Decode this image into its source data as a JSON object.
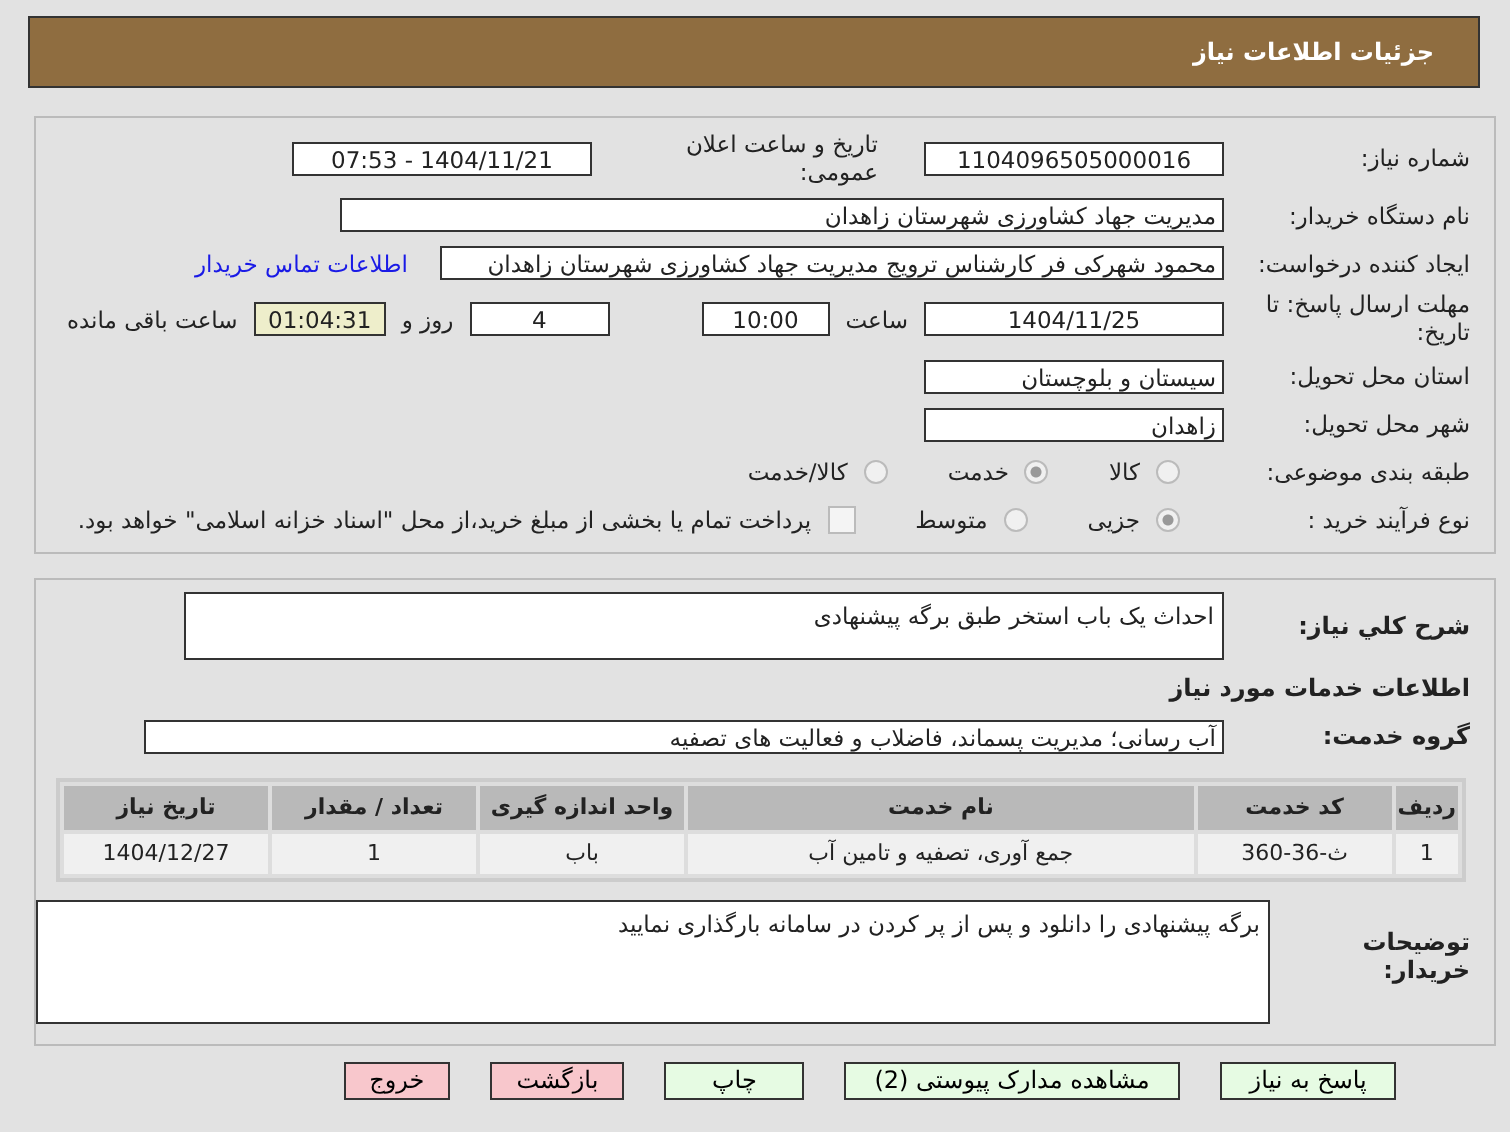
{
  "header": {
    "title": "جزئیات اطلاعات نیاز"
  },
  "need_number": {
    "label": "شماره نیاز:",
    "value": "1104096505000016"
  },
  "announce": {
    "label": "تاریخ و ساعت اعلان عمومی:",
    "value": "1404/11/21 - 07:53"
  },
  "buyer": {
    "label": "نام دستگاه خریدار:",
    "value": "مدیریت جهاد کشاورزی شهرستان زاهدان"
  },
  "creator": {
    "label": "ایجاد کننده درخواست:",
    "value": "محمود شهرکی فر کارشناس ترویج مدیریت جهاد کشاورزی شهرستان زاهدان",
    "link": "اطلاعات تماس خریدار"
  },
  "deadline": {
    "label": "مهلت ارسال پاسخ: تا تاریخ:",
    "date": "1404/11/25",
    "time_label": "ساعت",
    "time": "10:00",
    "days": "4",
    "days_label": "روز و",
    "remaining": "01:04:31",
    "remaining_label": "ساعت باقی مانده"
  },
  "province": {
    "label": "استان محل تحویل:",
    "value": "سیستان و بلوچستان"
  },
  "city": {
    "label": "شهر محل تحویل:",
    "value": "زاهدان"
  },
  "category": {
    "label": "طبقه بندی موضوعی:",
    "options": [
      {
        "label": "کالا",
        "selected": false
      },
      {
        "label": "خدمت",
        "selected": true
      },
      {
        "label": "کالا/خدمت",
        "selected": false
      }
    ]
  },
  "process": {
    "label": "نوع فرآیند خرید :",
    "options": [
      {
        "label": "جزیی",
        "selected": true
      },
      {
        "label": "متوسط",
        "selected": false
      }
    ],
    "checkbox": {
      "checked": false,
      "label": "پرداخت تمام یا بخشی از مبلغ خرید،از محل \"اسناد خزانه اسلامی\" خواهد بود."
    }
  },
  "description": {
    "label": "شرح کلي نياز:",
    "value": "احداث یک باب استخر طبق برگه پیشنهادی"
  },
  "services_title": "اطلاعات خدمات مورد نیاز",
  "service_group": {
    "label": "گروه خدمت:",
    "value": "آب رسانی؛ مدیریت پسماند، فاضلاب و فعالیت های تصفیه"
  },
  "table": {
    "columns": [
      "ردیف",
      "کد خدمت",
      "نام خدمت",
      "واحد اندازه گیری",
      "تعداد / مقدار",
      "تاریخ نیاز"
    ],
    "rows": [
      [
        "1",
        "ث-36-360",
        "جمع آوری، تصفیه و تامین آب",
        "باب",
        "1",
        "1404/12/27"
      ]
    ]
  },
  "buyer_notes": {
    "label": "توضیحات خریدار:",
    "value": "برگه پیشنهادی را دانلود و پس از پر کردن در سامانه بارگذاری نمایید"
  },
  "buttons": [
    {
      "label": "پاسخ به نیاز",
      "kind": "primary"
    },
    {
      "label": "مشاهده مدارک پیوستی (2)",
      "kind": "primary"
    },
    {
      "label": "چاپ",
      "kind": "primary"
    },
    {
      "label": "بازگشت",
      "kind": "danger"
    },
    {
      "label": "خروج",
      "kind": "danger"
    }
  ]
}
